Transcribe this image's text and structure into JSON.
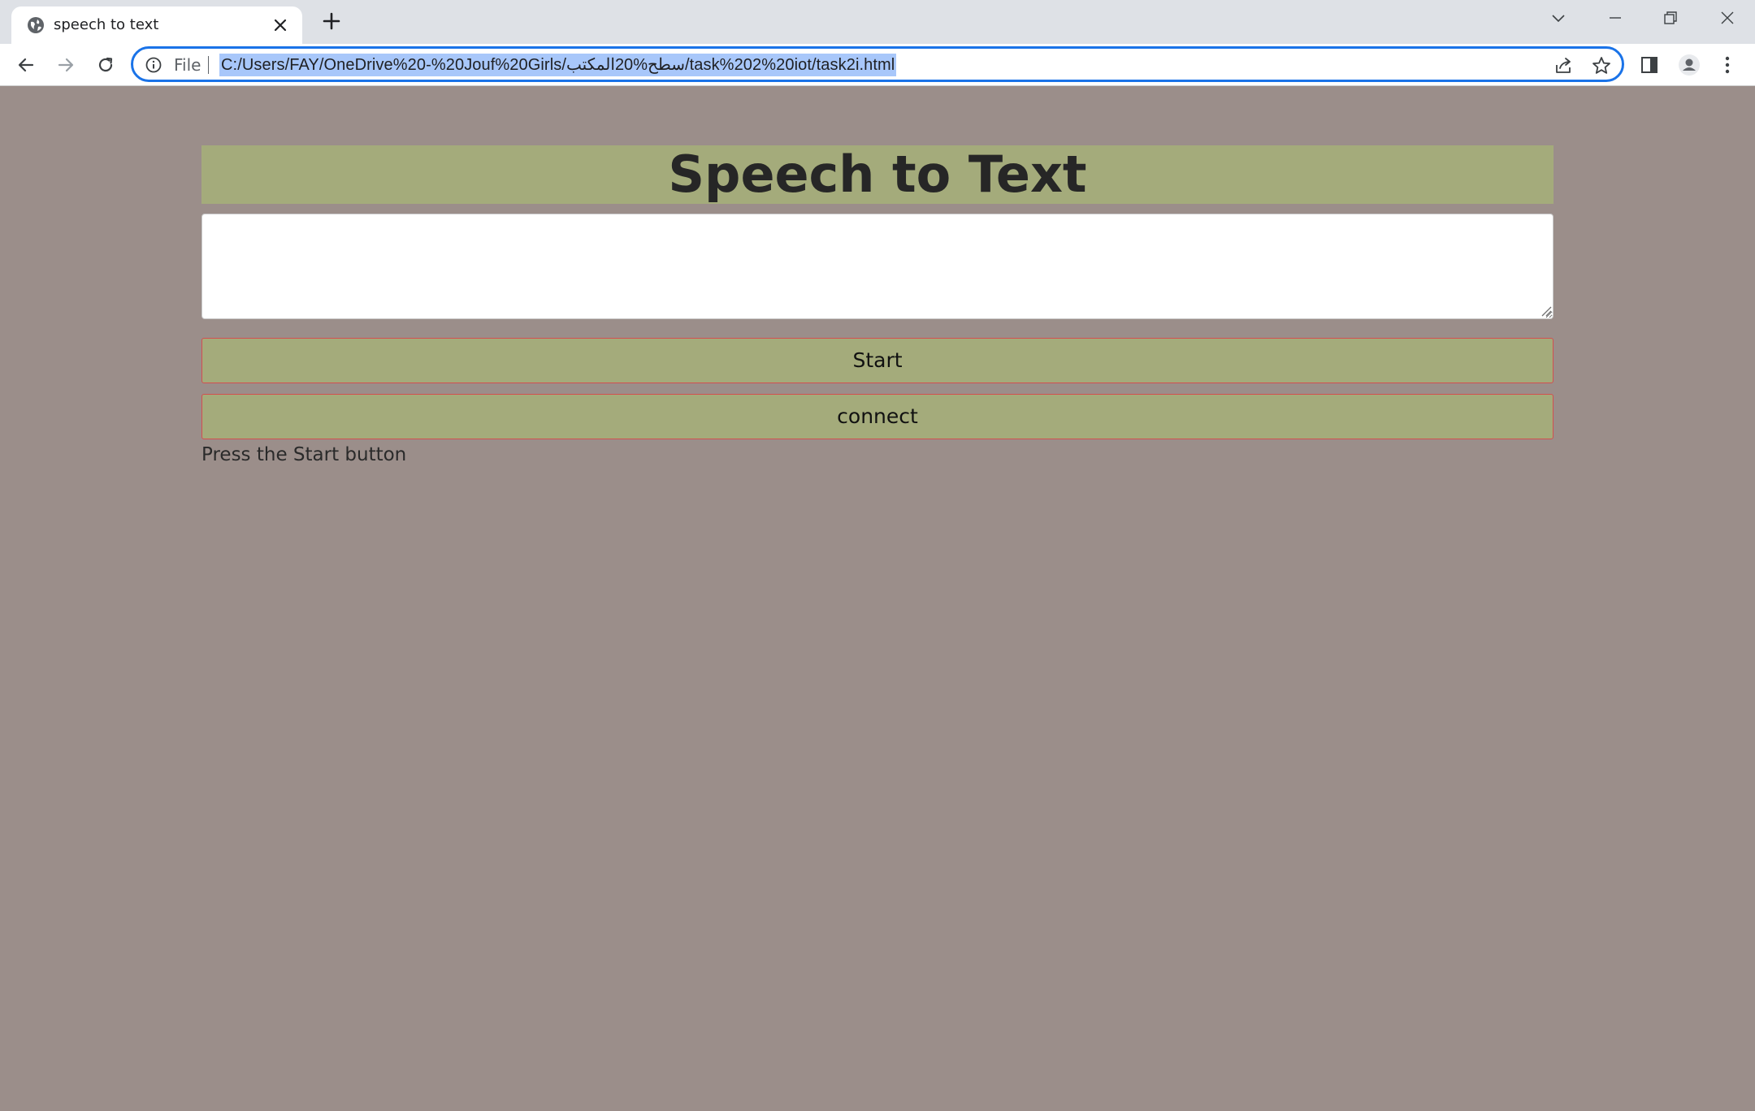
{
  "browser": {
    "tab": {
      "title": "speech to text"
    },
    "address_bar": {
      "scheme_label": "File",
      "url": "C:/Users/FAY/OneDrive%20-%20Jouf%20Girls/سطح%20المكتب/task%202%20iot/task2i.html"
    }
  },
  "page": {
    "heading": "Speech to Text",
    "textarea_value": "",
    "start_button": "Start",
    "connect_button": "connect",
    "status_text": "Press the Start button"
  },
  "colors": {
    "page_background": "#9b8e8a",
    "accent_olive": "#a4ab7b",
    "button_border": "#d24f4f",
    "omnibox_focus": "#1a73e8",
    "url_selection": "#a8c7fa"
  },
  "icons": [
    "globe-icon",
    "close-icon",
    "plus-icon",
    "chevron-down-icon",
    "minimize-icon",
    "restore-icon",
    "window-close-icon",
    "back-icon",
    "forward-icon",
    "reload-icon",
    "info-icon",
    "share-icon",
    "star-icon",
    "side-panel-icon",
    "profile-icon",
    "more-menu-icon"
  ]
}
